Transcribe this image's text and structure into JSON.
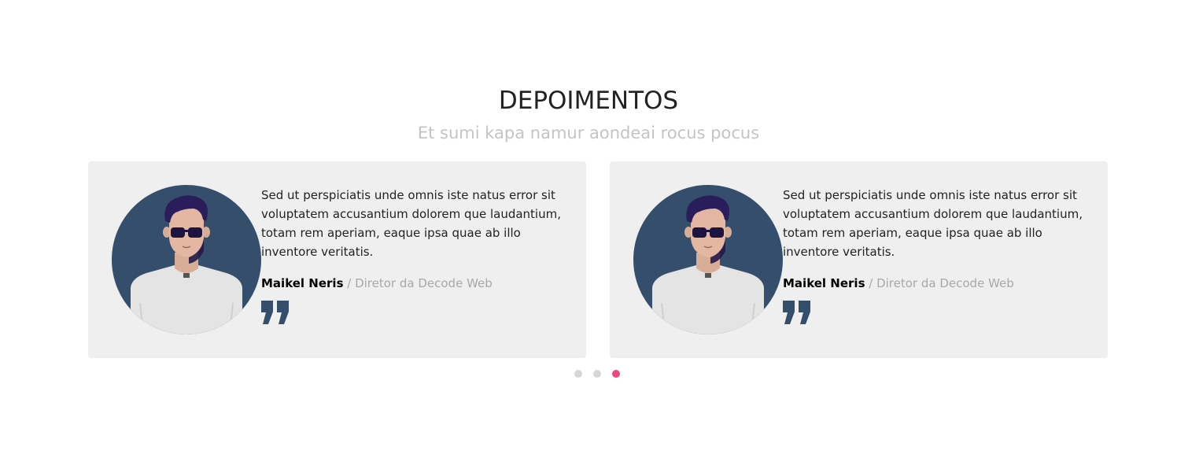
{
  "header": {
    "title": "DEPOIMENTOS",
    "subtitle": "Et sumi kapa namur aondeai rocus pocus"
  },
  "testimonials": [
    {
      "text": "Sed ut perspiciatis unde omnis iste natus error sit voluptatem accusantium dolorem que laudantium, totam rem aperiam, eaque ipsa quae ab illo inventore veritatis.",
      "author": "Maikel Neris",
      "separator": " / ",
      "role": "Diretor da Decode Web",
      "avatar_icon": "man-with-sunglasses-avatar",
      "quote_icon": "closing-quote-icon"
    },
    {
      "text": "Sed ut perspiciatis unde omnis iste natus error sit voluptatem accusantium dolorem que laudantium, totam rem aperiam, eaque ipsa quae ab illo inventore veritatis.",
      "author": "Maikel Neris",
      "separator": " / ",
      "role": "Diretor da Decode Web",
      "avatar_icon": "man-with-sunglasses-avatar",
      "quote_icon": "closing-quote-icon"
    }
  ],
  "carousel": {
    "page_count": 3,
    "active_page": 3
  },
  "colors": {
    "card_background": "#efefef",
    "avatar_background": "#354e6b",
    "quote_icon": "#354e6b",
    "dot_inactive": "#d6d6d6",
    "dot_active": "#f0457f",
    "subtitle": "#c4c4c4",
    "role_text": "#a8a8a8"
  }
}
